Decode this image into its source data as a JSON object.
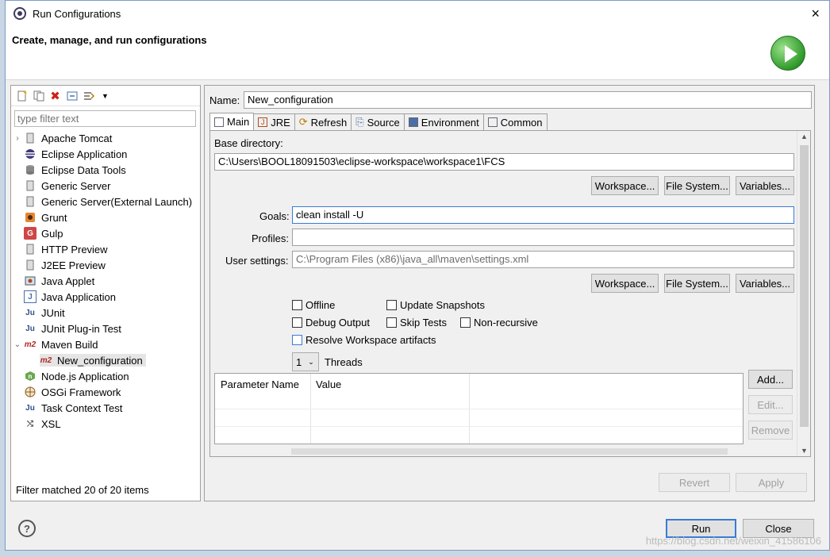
{
  "window": {
    "title": "Run Configurations",
    "close": "×"
  },
  "banner": {
    "title": "Create, manage, and run configurations"
  },
  "left": {
    "filter_placeholder": "type filter text",
    "items": [
      {
        "label": "Apache Tomcat",
        "icon": "tomcat-icon",
        "expander": "›"
      },
      {
        "label": "Eclipse Application",
        "icon": "eclipse-icon"
      },
      {
        "label": "Eclipse Data Tools",
        "icon": "database-icon"
      },
      {
        "label": "Generic Server",
        "icon": "server-icon"
      },
      {
        "label": "Generic Server(External Launch)",
        "icon": "server-icon"
      },
      {
        "label": "Grunt",
        "icon": "grunt-icon"
      },
      {
        "label": "Gulp",
        "icon": "gulp-icon"
      },
      {
        "label": "HTTP Preview",
        "icon": "server-icon"
      },
      {
        "label": "J2EE Preview",
        "icon": "server-icon"
      },
      {
        "label": "Java Applet",
        "icon": "applet-icon"
      },
      {
        "label": "Java Application",
        "icon": "java-app-icon"
      },
      {
        "label": "JUnit",
        "icon": "junit-icon"
      },
      {
        "label": "JUnit Plug-in Test",
        "icon": "junit-plugin-icon"
      },
      {
        "label": "Maven Build",
        "icon": "m2-icon",
        "expander": "⌄"
      },
      {
        "label": "New_configuration",
        "icon": "m2-icon"
      },
      {
        "label": "Node.js Application",
        "icon": "nodejs-icon"
      },
      {
        "label": "OSGi Framework",
        "icon": "osgi-icon"
      },
      {
        "label": "Task Context Test",
        "icon": "junit-icon"
      },
      {
        "label": "XSL",
        "icon": "xsl-icon"
      }
    ],
    "status": "Filter matched 20 of 20 items"
  },
  "right": {
    "name_label": "Name:",
    "name_value": "New_configuration",
    "tabs": [
      {
        "label": "Main",
        "icon": "main-tab-icon"
      },
      {
        "label": "JRE",
        "icon": "jre-icon"
      },
      {
        "label": "Refresh",
        "icon": "refresh-icon"
      },
      {
        "label": "Source",
        "icon": "source-icon"
      },
      {
        "label": "Environment",
        "icon": "environment-icon"
      },
      {
        "label": "Common",
        "icon": "common-icon"
      }
    ],
    "main": {
      "base_dir_label": "Base directory:",
      "base_dir_value": "C:\\Users\\BOOL18091503\\eclipse-workspace\\workspace1\\FCS",
      "workspace_btn": "Workspace...",
      "filesystem_btn": "File System...",
      "variables_btn": "Variables...",
      "goals_label": "Goals:",
      "goals_value": "clean install -U",
      "profiles_label": "Profiles:",
      "profiles_value": "",
      "user_settings_label": "User settings:",
      "user_settings_value": "C:\\Program Files (x86)\\java_all\\maven\\settings.xml",
      "checks": {
        "offline": "Offline",
        "update_snapshots": "Update Snapshots",
        "debug_output": "Debug Output",
        "skip_tests": "Skip Tests",
        "non_recursive": "Non-recursive",
        "resolve_workspace": "Resolve Workspace artifacts"
      },
      "threads_value": "1",
      "threads_label": "Threads",
      "table_headers": {
        "param": "Parameter Name",
        "value": "Value"
      },
      "add_btn": "Add...",
      "edit_btn": "Edit...",
      "remove_btn": "Remove"
    },
    "revert_btn": "Revert",
    "apply_btn": "Apply"
  },
  "footer": {
    "help": "?",
    "run_btn": "Run",
    "close_btn": "Close",
    "watermark": "https://blog.csdn.net/weixin_41586106"
  }
}
